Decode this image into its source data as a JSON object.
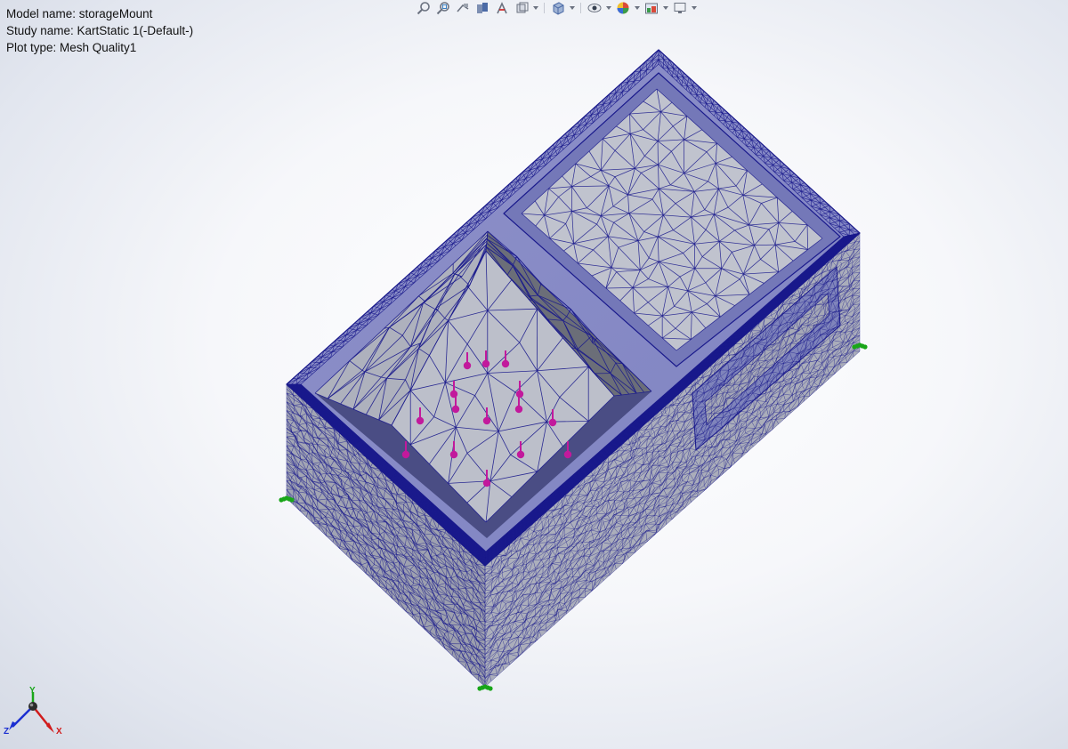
{
  "info": {
    "model_name": "Model name: storageMount",
    "study_name": "Study name: KartStatic 1(-Default-)",
    "plot_type": "Plot type: Mesh Quality1"
  },
  "toolbar": {
    "icons": [
      "zoom-to-fit-icon",
      "zoom-to-area-icon",
      "previous-view-icon",
      "section-view-icon",
      "dynamic-annotation-icon",
      "view-orientation-icon",
      "display-style-icon",
      "hide-show-items-icon",
      "edit-appearance-icon",
      "apply-scene-icon",
      "view-settings-icon"
    ]
  },
  "triad": {
    "y_label": "Y",
    "x_label": "X",
    "z_label": "Z"
  },
  "colors": {
    "mesh_line": "#1a1a8c",
    "face_light": "#c3c6cd",
    "face_mid": "#a9adb6",
    "face_dark": "#8e929c",
    "load_marker": "#c2199c",
    "fixture_marker": "#19a619",
    "axis_x": "#d11b1b",
    "axis_y": "#19a619",
    "axis_z": "#1b2fd1"
  }
}
